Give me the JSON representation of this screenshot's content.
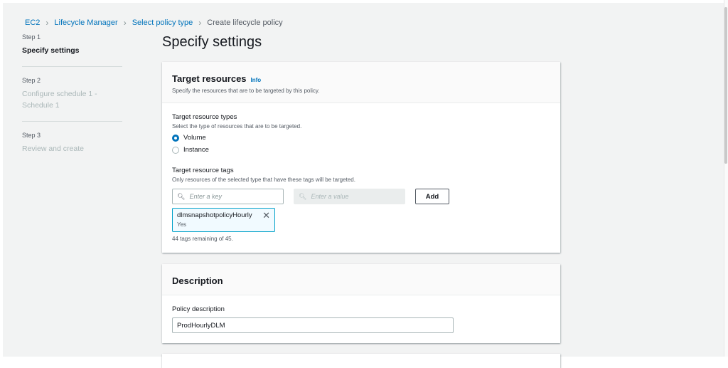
{
  "breadcrumb": [
    "EC2",
    "Lifecycle Manager",
    "Select policy type",
    "Create lifecycle policy"
  ],
  "steps": [
    {
      "number": "Step 1",
      "title": "Specify settings"
    },
    {
      "number": "Step 2",
      "title": "Configure schedule 1 - Schedule 1"
    },
    {
      "number": "Step 3",
      "title": "Review and create"
    }
  ],
  "page_title": "Specify settings",
  "target": {
    "title": "Target resources",
    "info": "Info",
    "description": "Specify the resources that are to be targeted by this policy.",
    "types_label": "Target resource types",
    "types_desc": "Select the type of resources that are to be targeted.",
    "options": [
      "Volume",
      "Instance"
    ],
    "selected": "Volume",
    "tags_label": "Target resource tags",
    "tags_desc": "Only resources of the selected type that have these tags will be targeted.",
    "key_placeholder": "Enter a key",
    "value_placeholder": "Enter a value",
    "add_label": "Add",
    "tag": {
      "key": "dlmsnapshotpolicyHourly",
      "value": "Yes"
    },
    "remaining": "44 tags remaining of 45."
  },
  "description": {
    "title": "Description",
    "field_label": "Policy description",
    "value": "ProdHourlyDLM"
  }
}
